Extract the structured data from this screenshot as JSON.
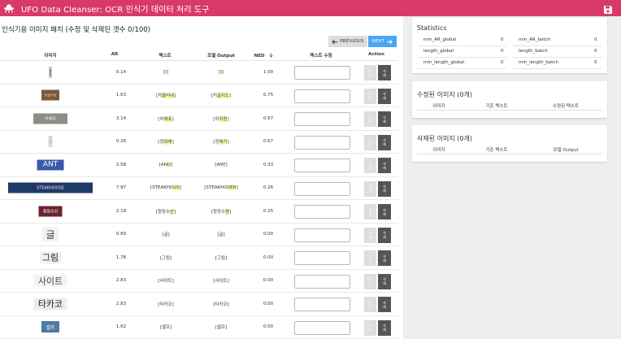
{
  "app": {
    "title": "UFO Data Cleanser: OCR 인식기 데이터 처리 도구",
    "accent_color": "#d9396a",
    "logo_icon": "ufo-icon",
    "save_icon": "save-icon"
  },
  "main": {
    "heading": "인식기용 이미지 패치 (수정 및 삭제된 갯수 0/100)",
    "prev_label": "PREVIOUS",
    "next_label": "NEXT",
    "columns": {
      "image": "이미지",
      "ar": "AR",
      "text": "텍스트",
      "model_output": "모델 Output",
      "ned": "NED",
      "edit_text": "텍스트 수정",
      "action": "Action"
    },
    "sort_icon": "arrow-down-icon",
    "action_labels": {
      "edit_top": "수",
      "edit_bottom": "정",
      "delete_top": "삭",
      "delete_bottom": "제"
    },
    "rows": [
      {
        "ar": "0.14",
        "gt_pre": "[",
        "gt_hl": "l",
        "gt_post": "]",
        "mo_pre": "[",
        "mo_hl": "l",
        "mo_post": "]",
        "ned": "1.00",
        "thumb_text": "|"
      },
      {
        "ar": "1.63",
        "gt_pre": "[커",
        "gt_hl": "클리내",
        "gt_post": "]",
        "mo_pre": "[커",
        "mo_hl": "글지도",
        "mo_post": "]",
        "ned": "0.75",
        "thumb_text": "커클리내"
      },
      {
        "ar": "3.14",
        "gt_pre": "[차",
        "gt_hl": "채죠",
        "gt_post": "]",
        "mo_pre": "[차",
        "mo_hl": "지림",
        "mo_post": "]",
        "ned": "0.67",
        "thumb_text": "차채죠"
      },
      {
        "ar": "0.26",
        "gt_pre": "[정",
        "gt_hl": "화채",
        "gt_post": "]",
        "mo_pre": "[정",
        "mo_hl": "체가",
        "mo_post": "]",
        "ned": "0.67",
        "thumb_text": "정"
      },
      {
        "ar": "2.58",
        "gt_pre": "[AN",
        "gt_hl": "D",
        "gt_post": "]",
        "mo_pre": "[AN",
        "mo_hl": "T",
        "mo_post": "]",
        "ned": "0.33",
        "thumb_text": "ANT"
      },
      {
        "ar": "7.97",
        "gt_pre": "[STEAKHO",
        "gt_hl": "US",
        "gt_post": "]",
        "mo_pre": "[STEAKHO",
        "mo_hl": "VER",
        "mo_post": "]",
        "ned": "0.26",
        "thumb_text": "STEAKHOUSE"
      },
      {
        "ar": "2.19",
        "gt_pre": "[청정수",
        "gt_hl": "산",
        "gt_post": "]",
        "mo_pre": "[청정수",
        "mo_hl": "명",
        "mo_post": "]",
        "ned": "0.25",
        "thumb_text": "청정수산"
      },
      {
        "ar": "0.89",
        "gt_pre": "[글]",
        "gt_hl": "",
        "gt_post": "",
        "mo_pre": "[글]",
        "mo_hl": "",
        "mo_post": "",
        "ned": "0.00",
        "thumb_text": "글"
      },
      {
        "ar": "1.78",
        "gt_pre": "[그림]",
        "gt_hl": "",
        "gt_post": "",
        "mo_pre": "[그림]",
        "mo_hl": "",
        "mo_post": "",
        "ned": "0.00",
        "thumb_text": "그림"
      },
      {
        "ar": "2.83",
        "gt_pre": "[사이트]",
        "gt_hl": "",
        "gt_post": "",
        "mo_pre": "[사이트]",
        "mo_hl": "",
        "mo_post": "",
        "ned": "0.00",
        "thumb_text": "사이트"
      },
      {
        "ar": "2.83",
        "gt_pre": "[타카코]",
        "gt_hl": "",
        "gt_post": "",
        "mo_pre": "[타카코]",
        "mo_hl": "",
        "mo_post": "",
        "ned": "0.00",
        "thumb_text": "타카코"
      },
      {
        "ar": "1.62",
        "gt_pre": "[셀프]",
        "gt_hl": "",
        "gt_post": "",
        "mo_pre": "[셀프]",
        "mo_hl": "",
        "mo_post": "",
        "ned": "0.00",
        "thumb_text": "셀프"
      }
    ]
  },
  "statistics": {
    "title": "Statistics",
    "items": [
      {
        "label": "min_AR_global",
        "value": "0"
      },
      {
        "label": "min_AR_batch",
        "value": "0"
      },
      {
        "label": "length_global",
        "value": "0"
      },
      {
        "label": "length_batch",
        "value": "0"
      },
      {
        "label": "min_length_global",
        "value": "0"
      },
      {
        "label": "min_length_batch",
        "value": "0"
      }
    ]
  },
  "modified": {
    "title": "수정된 이미지 (0개)",
    "col_image": "이미지",
    "col_original": "기존 텍스트",
    "col_modified": "수정된 텍스트"
  },
  "deleted": {
    "title": "삭제된 이미지 (0개)",
    "col_image": "이미지",
    "col_original": "기존 텍스트",
    "col_model": "모델 Output"
  }
}
